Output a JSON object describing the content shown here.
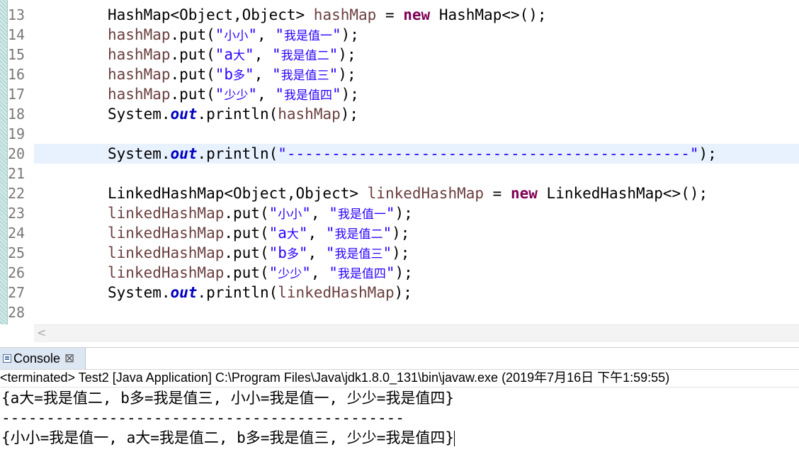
{
  "editor": {
    "lines": [
      {
        "num": "13",
        "parts": [
          [
            "",
            "HashMap<Object,Object> "
          ],
          [
            "var",
            "hashMap"
          ],
          [
            "",
            " = "
          ],
          [
            "kw",
            "new"
          ],
          [
            "",
            " HashMap<>();"
          ]
        ]
      },
      {
        "num": "14",
        "parts": [
          [
            "var",
            "hashMap"
          ],
          [
            "",
            ".put("
          ],
          [
            "str",
            "\""
          ],
          [
            "strc",
            "小小"
          ],
          [
            "str",
            "\""
          ],
          [
            "",
            ", "
          ],
          [
            "str",
            "\""
          ],
          [
            "strc",
            "我是值一"
          ],
          [
            "str",
            "\""
          ],
          [
            "",
            ");"
          ]
        ]
      },
      {
        "num": "15",
        "parts": [
          [
            "var",
            "hashMap"
          ],
          [
            "",
            ".put("
          ],
          [
            "str",
            "\"a"
          ],
          [
            "strc",
            "大"
          ],
          [
            "str",
            "\""
          ],
          [
            "",
            ", "
          ],
          [
            "str",
            "\""
          ],
          [
            "strc",
            "我是值二"
          ],
          [
            "str",
            "\""
          ],
          [
            "",
            ");"
          ]
        ]
      },
      {
        "num": "16",
        "parts": [
          [
            "var",
            "hashMap"
          ],
          [
            "",
            ".put("
          ],
          [
            "str",
            "\"b"
          ],
          [
            "strc",
            "多"
          ],
          [
            "str",
            "\""
          ],
          [
            "",
            ", "
          ],
          [
            "str",
            "\""
          ],
          [
            "strc",
            "我是值三"
          ],
          [
            "str",
            "\""
          ],
          [
            "",
            ");"
          ]
        ]
      },
      {
        "num": "17",
        "parts": [
          [
            "var",
            "hashMap"
          ],
          [
            "",
            ".put("
          ],
          [
            "str",
            "\""
          ],
          [
            "strc",
            "少少"
          ],
          [
            "str",
            "\""
          ],
          [
            "",
            ", "
          ],
          [
            "str",
            "\""
          ],
          [
            "strc",
            "我是值四"
          ],
          [
            "str",
            "\""
          ],
          [
            "",
            ");"
          ]
        ]
      },
      {
        "num": "18",
        "parts": [
          [
            "",
            "System."
          ],
          [
            "fld",
            "out"
          ],
          [
            "",
            ".println("
          ],
          [
            "var",
            "hashMap"
          ],
          [
            "",
            ");"
          ]
        ]
      },
      {
        "num": "19",
        "parts": []
      },
      {
        "num": "20",
        "current": true,
        "parts": [
          [
            "",
            "System."
          ],
          [
            "fld",
            "out"
          ],
          [
            "",
            ".println("
          ],
          [
            "str",
            "\"---------------------------------------------\""
          ],
          [
            "",
            ");"
          ]
        ]
      },
      {
        "num": "21",
        "parts": []
      },
      {
        "num": "22",
        "parts": [
          [
            "",
            "LinkedHashMap<Object,Object> "
          ],
          [
            "var",
            "linkedHashMap"
          ],
          [
            "",
            " = "
          ],
          [
            "kw",
            "new"
          ],
          [
            "",
            " LinkedHashMap<>();"
          ]
        ]
      },
      {
        "num": "23",
        "parts": [
          [
            "var",
            "linkedHashMap"
          ],
          [
            "",
            ".put("
          ],
          [
            "str",
            "\""
          ],
          [
            "strc",
            "小小"
          ],
          [
            "str",
            "\""
          ],
          [
            "",
            ", "
          ],
          [
            "str",
            "\""
          ],
          [
            "strc",
            "我是值一"
          ],
          [
            "str",
            "\""
          ],
          [
            "",
            ");"
          ]
        ]
      },
      {
        "num": "24",
        "parts": [
          [
            "var",
            "linkedHashMap"
          ],
          [
            "",
            ".put("
          ],
          [
            "str",
            "\"a"
          ],
          [
            "strc",
            "大"
          ],
          [
            "str",
            "\""
          ],
          [
            "",
            ", "
          ],
          [
            "str",
            "\""
          ],
          [
            "strc",
            "我是值二"
          ],
          [
            "str",
            "\""
          ],
          [
            "",
            ");"
          ]
        ]
      },
      {
        "num": "25",
        "parts": [
          [
            "var",
            "linkedHashMap"
          ],
          [
            "",
            ".put("
          ],
          [
            "str",
            "\"b"
          ],
          [
            "strc",
            "多"
          ],
          [
            "str",
            "\""
          ],
          [
            "",
            ", "
          ],
          [
            "str",
            "\""
          ],
          [
            "strc",
            "我是值三"
          ],
          [
            "str",
            "\""
          ],
          [
            "",
            ");"
          ]
        ]
      },
      {
        "num": "26",
        "parts": [
          [
            "var",
            "linkedHashMap"
          ],
          [
            "",
            ".put("
          ],
          [
            "str",
            "\""
          ],
          [
            "strc",
            "少少"
          ],
          [
            "str",
            "\""
          ],
          [
            "",
            ", "
          ],
          [
            "str",
            "\""
          ],
          [
            "strc",
            "我是值四"
          ],
          [
            "str",
            "\""
          ],
          [
            "",
            ");"
          ]
        ]
      },
      {
        "num": "27",
        "parts": [
          [
            "",
            "System."
          ],
          [
            "fld",
            "out"
          ],
          [
            "",
            ".println("
          ],
          [
            "var",
            "linkedHashMap"
          ],
          [
            "",
            ");"
          ]
        ]
      },
      {
        "num": "28",
        "parts": []
      }
    ]
  },
  "scrollbar": {
    "left_arrow": "<"
  },
  "console": {
    "tab_label": "Console",
    "close_glyph": "⊠",
    "status": "<terminated> Test2 [Java Application] C:\\Program Files\\Java\\jdk1.8.0_131\\bin\\javaw.exe (2019年7月16日 下午1:59:55)",
    "output": [
      "{a大=我是值二, b多=我是值三, 小小=我是值一, 少少=我是值四}",
      "---------------------------------------------",
      "{小小=我是值一, a大=我是值二, b多=我是值三, 少少=我是值四}"
    ]
  },
  "icons": {
    "console": "console-icon",
    "close": "close-icon",
    "scroll_left": "chevron-left-icon"
  }
}
